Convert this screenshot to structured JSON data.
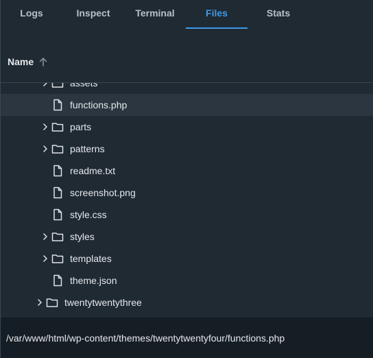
{
  "tabs": [
    {
      "label": "Logs",
      "active": false
    },
    {
      "label": "Inspect",
      "active": false
    },
    {
      "label": "Terminal",
      "active": false
    },
    {
      "label": "Files",
      "active": true
    },
    {
      "label": "Stats",
      "active": false
    }
  ],
  "column_header": {
    "name_label": "Name",
    "sort_icon": "arrow-up-icon"
  },
  "tree": {
    "rows": [
      {
        "label": "assets",
        "type": "folder",
        "expandable": true,
        "level": 2
      },
      {
        "label": "functions.php",
        "type": "file",
        "expandable": false,
        "level": 2,
        "selected": true
      },
      {
        "label": "parts",
        "type": "folder",
        "expandable": true,
        "level": 2
      },
      {
        "label": "patterns",
        "type": "folder",
        "expandable": true,
        "level": 2
      },
      {
        "label": "readme.txt",
        "type": "file",
        "expandable": false,
        "level": 2
      },
      {
        "label": "screenshot.png",
        "type": "file",
        "expandable": false,
        "level": 2
      },
      {
        "label": "style.css",
        "type": "file",
        "expandable": false,
        "level": 2
      },
      {
        "label": "styles",
        "type": "folder",
        "expandable": true,
        "level": 2
      },
      {
        "label": "templates",
        "type": "folder",
        "expandable": true,
        "level": 2
      },
      {
        "label": "theme.json",
        "type": "file",
        "expandable": false,
        "level": 2
      },
      {
        "label": "twentytwentythree",
        "type": "folder",
        "expandable": true,
        "level": 1
      }
    ]
  },
  "footer": {
    "path": "/var/www/html/wp-content/themes/twentytwentyfour/functions.php"
  },
  "colors": {
    "background": "#202a33",
    "accent": "#3d9ae8",
    "footer_background": "#161e25",
    "selected_row": "#2b3640"
  }
}
